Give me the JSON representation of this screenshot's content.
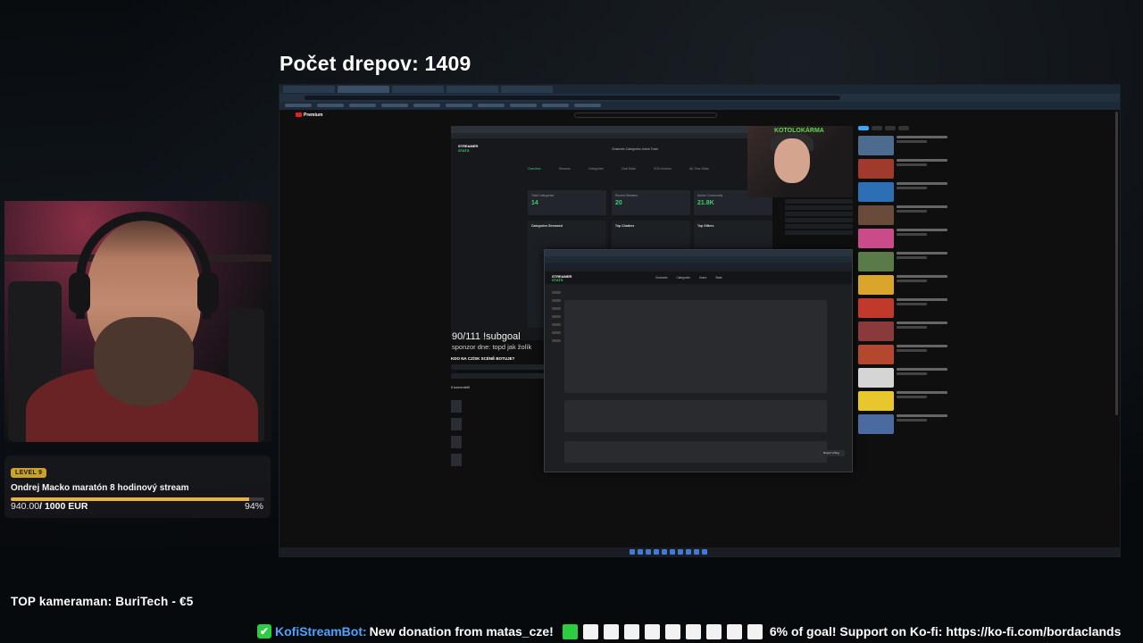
{
  "overlay": {
    "drep_counter": "Počet drepov: 1409",
    "subgoal": "90/111 !subgoal",
    "sponsor": "sponzor dne: topd jak žolík",
    "top_cameraman": "TOP kameraman: BuriTech - €5"
  },
  "goal": {
    "level": "LEVEL 9",
    "title": "Ondrej Macko maratón 8 hodinový stream",
    "current": "940.00",
    "target": "/ 1000 EUR",
    "percent_label": "94%",
    "progress": 0.94,
    "accent_color": "#e6b43c"
  },
  "ticker": {
    "icon": "check-icon",
    "bot": "KofiStreamBot:",
    "message": "New donation from matas_cze!",
    "squares_total": 10,
    "squares_filled": 1,
    "goal_text": "6% of goal! Support on Ko-fi: https://ko-fi.com/bordaclands"
  },
  "screen": {
    "youtube_brand": "Premium",
    "inner_cam_banner": "KOTOLOKÁRMA",
    "streamer_stats_logo": [
      "STREAMER",
      "STATS"
    ],
    "stats": [
      {
        "label": "Total Categories",
        "value": "14"
      },
      {
        "label": "Recent Streams",
        "value": "20"
      },
      {
        "label": "Active Community",
        "value": "21.8K"
      }
    ],
    "panels": [
      "Categories Streamed",
      "Top Chatters",
      "Top Gifters"
    ],
    "nav_tabs": [
      "Overview",
      "Streams",
      "Categories",
      "Chat Stats",
      "VOD Archive",
      "All-Time Stats"
    ],
    "header_nav": "Channels   Categories   Users   Tools",
    "deep_menu": [
      "Channels",
      "Categories",
      "Users",
      "Stats"
    ],
    "report_bug": "Report a Bug",
    "yt_question": "KDO NA CZ/SK SCÉNĚ BOTUJE?",
    "comments_label": "5 komentářů"
  }
}
